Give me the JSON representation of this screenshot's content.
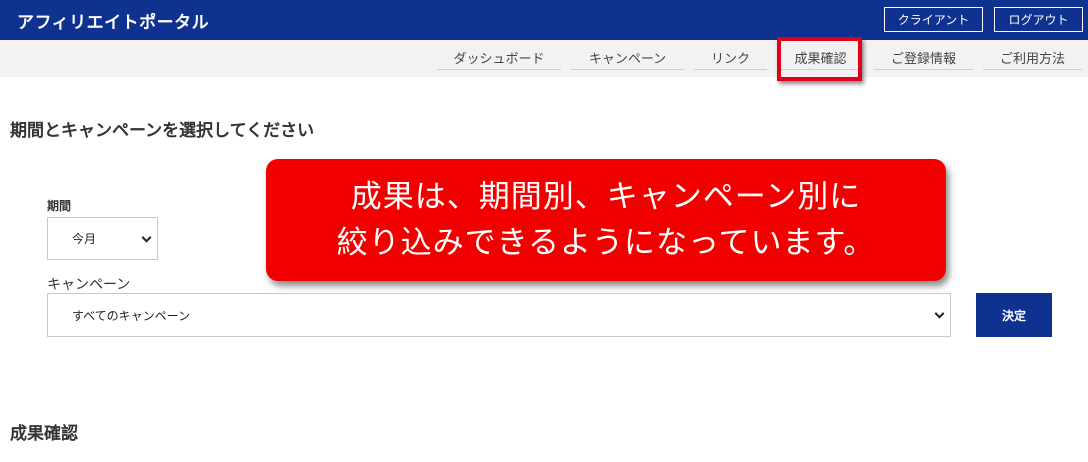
{
  "header": {
    "brand": "アフィリエイトポータル",
    "client_button": "クライアント",
    "logout_button": "ログアウト"
  },
  "nav": {
    "dashboard": "ダッシュボード",
    "campaign": "キャンペーン",
    "link": "リンク",
    "results": "成果確認",
    "register": "ご登録情報",
    "usage": "ご利用方法",
    "active": "成果確認"
  },
  "form": {
    "title": "期間とキャンペーンを選択してください",
    "period_label": "期間",
    "period_value": "今月",
    "campaign_label": "キャンペーン",
    "campaign_value": "すべてのキャンペーン",
    "submit_label": "決定"
  },
  "callout": {
    "line1": "成果は、期間別、キャンペーン別に",
    "line2": "絞り込みできるようになっています。"
  },
  "results": {
    "title": "成果確認"
  },
  "colors": {
    "brand_navy": "#0f3190",
    "callout_red": "#f20000",
    "highlight_red": "#e0001b"
  }
}
